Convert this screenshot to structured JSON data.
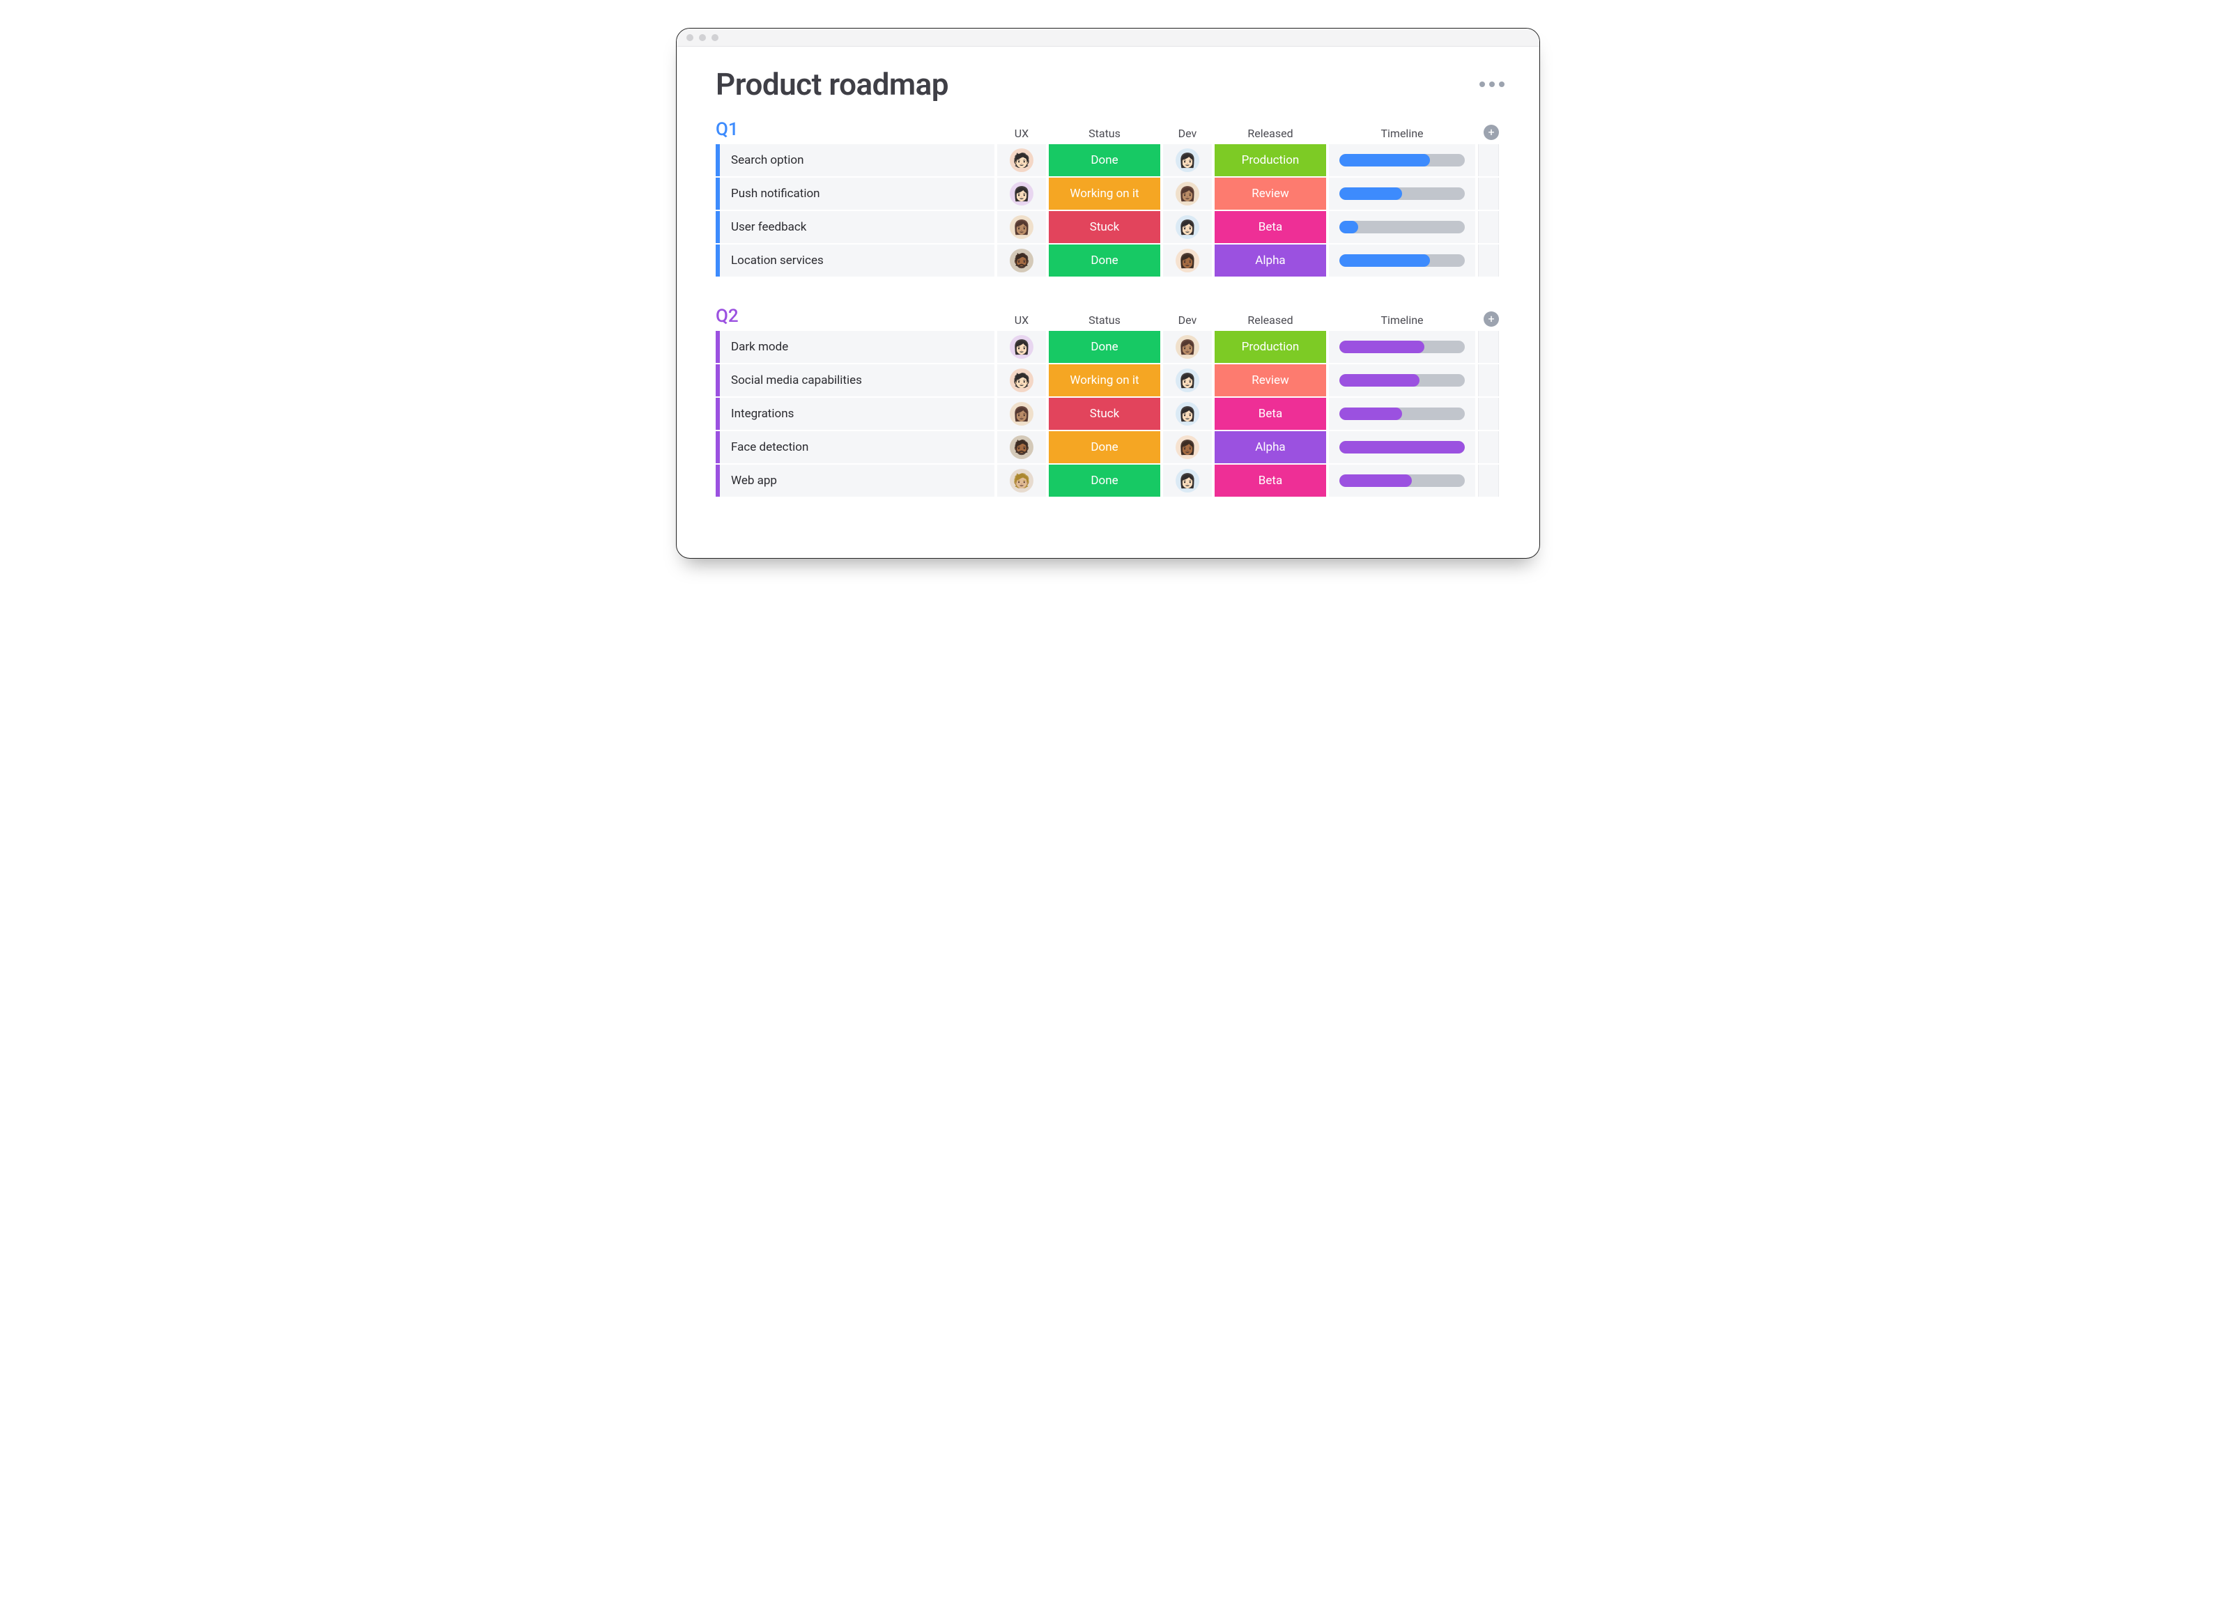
{
  "page": {
    "title": "Product roadmap"
  },
  "columns": {
    "ux": "UX",
    "status": "Status",
    "dev": "Dev",
    "released": "Released",
    "timeline": "Timeline"
  },
  "status_colors": {
    "Done": "#17c964",
    "Working on it": "#f5a623",
    "Stuck": "#e2445c"
  },
  "released_colors": {
    "Production": "#7dcb25",
    "Review": "#fd7b6f",
    "Beta": "#ee2f96",
    "Alpha": "#9b51e0"
  },
  "avatar_colors": {
    "a": "#f4d7c6",
    "b": "#e8d6f0",
    "c": "#f0e0cb",
    "d": "#dbeaf5",
    "e": "#d4c9b8",
    "f": "#f6e2d0",
    "g": "#e7dbcf"
  },
  "avatar_emoji": {
    "a": "🧑🏻",
    "b": "👩🏻",
    "c": "👩🏽",
    "d": "👩🏻",
    "e": "🧔🏾",
    "f": "👩🏾",
    "g": "🧑🏼"
  },
  "groups": [
    {
      "id": "q1",
      "title": "Q1",
      "accent": "#3d8bfd",
      "timeline_color": "#3d8bfd",
      "rows": [
        {
          "name": "Search option",
          "ux": "a",
          "status": "Done",
          "dev": "d",
          "released": "Production",
          "timeline": {
            "start": 0,
            "width": 72
          }
        },
        {
          "name": "Push notification",
          "ux": "b",
          "status": "Working on it",
          "dev": "c",
          "released": "Review",
          "timeline": {
            "start": 0,
            "width": 50
          }
        },
        {
          "name": "User feedback",
          "ux": "c",
          "status": "Stuck",
          "dev": "d",
          "released": "Beta",
          "timeline": {
            "start": 0,
            "width": 15
          }
        },
        {
          "name": "Location services",
          "ux": "e",
          "status": "Done",
          "dev": "f",
          "released": "Alpha",
          "timeline": {
            "start": 0,
            "width": 72
          }
        }
      ]
    },
    {
      "id": "q2",
      "title": "Q2",
      "accent": "#9b51e0",
      "timeline_color": "#9b51e0",
      "rows": [
        {
          "name": "Dark mode",
          "ux": "b",
          "status": "Done",
          "dev": "c",
          "released": "Production",
          "timeline": {
            "start": 0,
            "width": 68
          }
        },
        {
          "name": "Social media capabilities",
          "ux": "a",
          "status": "Working on it",
          "dev": "d",
          "released": "Review",
          "timeline": {
            "start": 0,
            "width": 64
          }
        },
        {
          "name": "Integrations",
          "ux": "c",
          "status": "Stuck",
          "dev": "d",
          "released": "Beta",
          "timeline": {
            "start": 0,
            "width": 50
          }
        },
        {
          "name": "Face detection",
          "ux": "e",
          "status": "Done",
          "status_color_override": "#f5a623",
          "dev": "f",
          "released": "Alpha",
          "timeline": {
            "start": 0,
            "width": 100
          }
        },
        {
          "name": "Web app",
          "ux": "g",
          "status": "Done",
          "dev": "d",
          "released": "Beta",
          "timeline": {
            "start": 0,
            "width": 58
          }
        }
      ]
    }
  ]
}
